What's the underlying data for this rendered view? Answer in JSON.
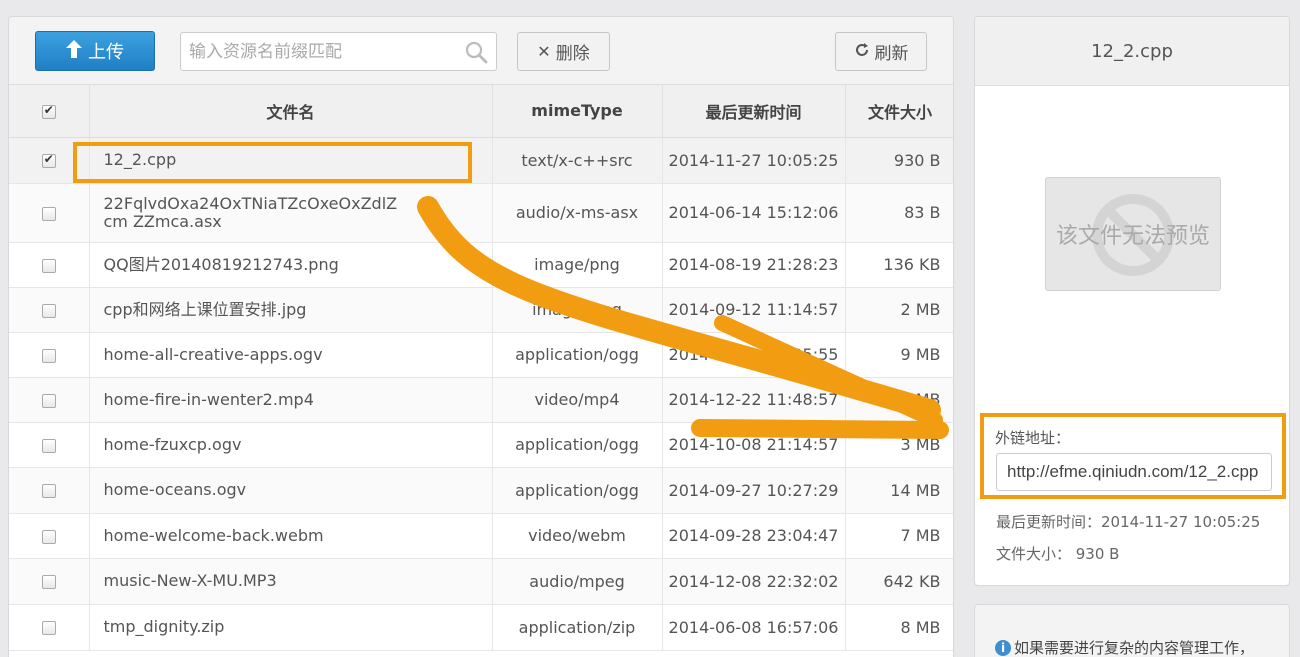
{
  "toolbar": {
    "upload_label": "上传",
    "search_placeholder": "输入资源名前缀匹配",
    "delete_label": "删除",
    "refresh_label": "刷新"
  },
  "table": {
    "headers": {
      "name": "文件名",
      "mime": "mimeType",
      "time": "最后更新时间",
      "size": "文件大小"
    },
    "rows": [
      {
        "name": "12_2.cpp",
        "mime": "text/x-c++src",
        "time": "2014-11-27 10:05:25",
        "size": "930 B"
      },
      {
        "name": "22FqlvdOxa24OxTNiaTZcOxeOxZdlZcm ZZmca.asx",
        "mime": "audio/x-ms-asx",
        "time": "2014-06-14 15:12:06",
        "size": "83 B"
      },
      {
        "name": "QQ图片20140819212743.png",
        "mime": "image/png",
        "time": "2014-08-19 21:28:23",
        "size": "136 KB"
      },
      {
        "name": "cpp和网络上课位置安排.jpg",
        "mime": "image/jpeg",
        "time": "2014-09-12 11:14:57",
        "size": "2 MB"
      },
      {
        "name": "home-all-creative-apps.ogv",
        "mime": "application/ogg",
        "time": "2014-10-13 11:05:55",
        "size": "9 MB"
      },
      {
        "name": "home-fire-in-wenter2.mp4",
        "mime": "video/mp4",
        "time": "2014-12-22 11:48:57",
        "size": "4 MB"
      },
      {
        "name": "home-fzuxcp.ogv",
        "mime": "application/ogg",
        "time": "2014-10-08 21:14:57",
        "size": "3 MB"
      },
      {
        "name": "home-oceans.ogv",
        "mime": "application/ogg",
        "time": "2014-09-27 10:27:29",
        "size": "14 MB"
      },
      {
        "name": "home-welcome-back.webm",
        "mime": "video/webm",
        "time": "2014-09-28 23:04:47",
        "size": "7 MB"
      },
      {
        "name": "music-New-X-MU.MP3",
        "mime": "audio/mpeg",
        "time": "2014-12-08 22:32:02",
        "size": "642 KB"
      },
      {
        "name": "tmp_dignity.zip",
        "mime": "application/zip",
        "time": "2014-06-08 16:57:06",
        "size": "8 MB"
      }
    ]
  },
  "preview": {
    "title": "12_2.cpp",
    "no_preview_text": "该文件无法预览",
    "link_label": "外链地址：",
    "link_value": "http://efme.qiniudn.com/12_2.cpp",
    "updated_line": "最后更新时间：2014-11-27 10:05:25",
    "size_line": "文件大小： 930 B"
  },
  "info": {
    "text": "如果需要进行复杂的内容管理工作，"
  },
  "colors": {
    "accent": "#2a8ad3",
    "annotation": "#f29c12"
  }
}
